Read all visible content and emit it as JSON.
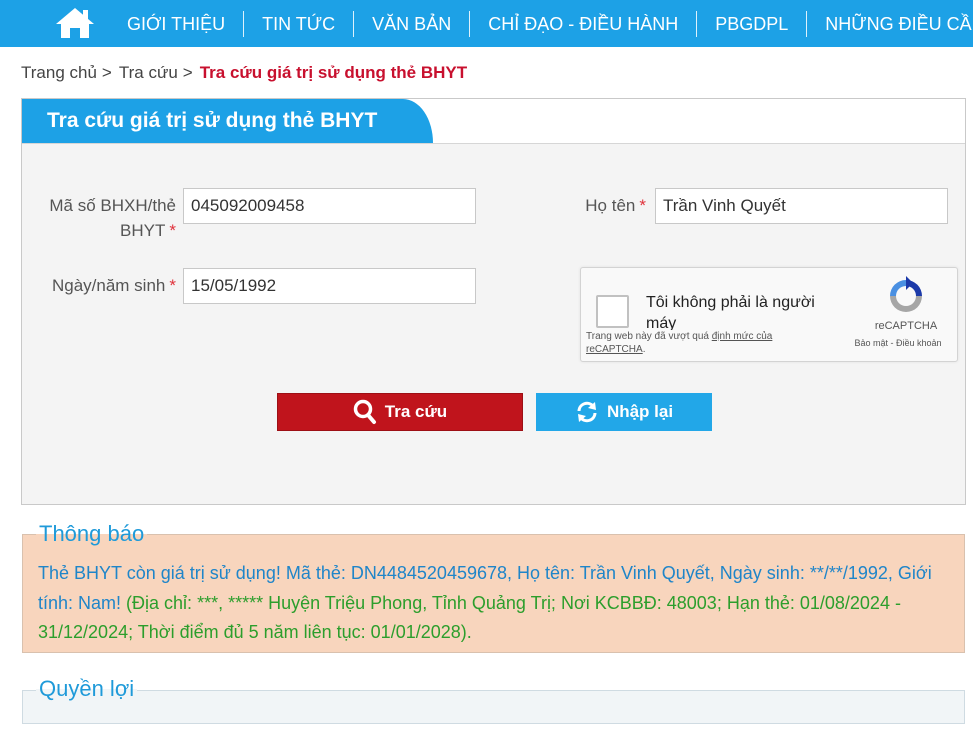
{
  "nav": {
    "home_icon": "home-icon",
    "items": [
      {
        "label": "GIỚI THIỆU"
      },
      {
        "label": "TIN TỨC"
      },
      {
        "label": "VĂN BẢN"
      },
      {
        "label": "CHỈ ĐẠO - ĐIỀU HÀNH"
      },
      {
        "label": "PBGDPL"
      },
      {
        "label": "NHỮNG ĐIỀU CẦN BIẾT"
      }
    ]
  },
  "breadcrumb": {
    "home": "Trang chủ",
    "lookup": "Tra cứu",
    "current": "Tra cứu giá trị sử dụng thẻ BHYT",
    "separator": ">"
  },
  "form": {
    "title": "Tra cứu giá trị sử dụng thẻ BHYT",
    "required_mark": "*",
    "card_label_line1": "Mã số BHXH/thẻ",
    "card_label_line2": "BHYT",
    "card_value": "045092009458",
    "name_label": "Họ tên",
    "name_value": "Trần Vinh Quyết",
    "dob_label": "Ngày/năm sinh",
    "dob_value": "15/05/1992",
    "search_button": "Tra cứu",
    "reset_button": "Nhập lại"
  },
  "captcha": {
    "checkbox_label": "Tôi không phải là người máy",
    "warning_prefix": "Trang web này đã vượt quá",
    "warning_link": "định mức của reCAPTCHA",
    "warning_suffix": ".",
    "brand": "reCAPTCHA",
    "links": "Bảo mật - Điều khoản"
  },
  "notice": {
    "title": "Thông báo",
    "text_blue": "Thẻ BHYT còn giá trị sử dụng! Mã thẻ: DN4484520459678, Họ tên: Trần Vinh Quyết, Ngày sinh: **/**/1992, Giới tính: Nam!",
    "text_green": "(Địa chỉ: ***, ***** Huyện Triệu Phong, Tỉnh Quảng Trị; Nơi KCBBĐ: 48003; Hạn thẻ: 01/08/2024 - 31/12/2024; Thời điểm đủ 5 năm liên tục: 01/01/2028)."
  },
  "benefits": {
    "title": "Quyền lợi"
  },
  "colors": {
    "nav_blue": "#1da1e6",
    "search_red": "#c0141c",
    "notice_bg": "#f8d5bd",
    "notice_blue": "#1f85c9",
    "notice_green": "#2c9e2c",
    "breadcrumb_current": "#c8102e"
  }
}
